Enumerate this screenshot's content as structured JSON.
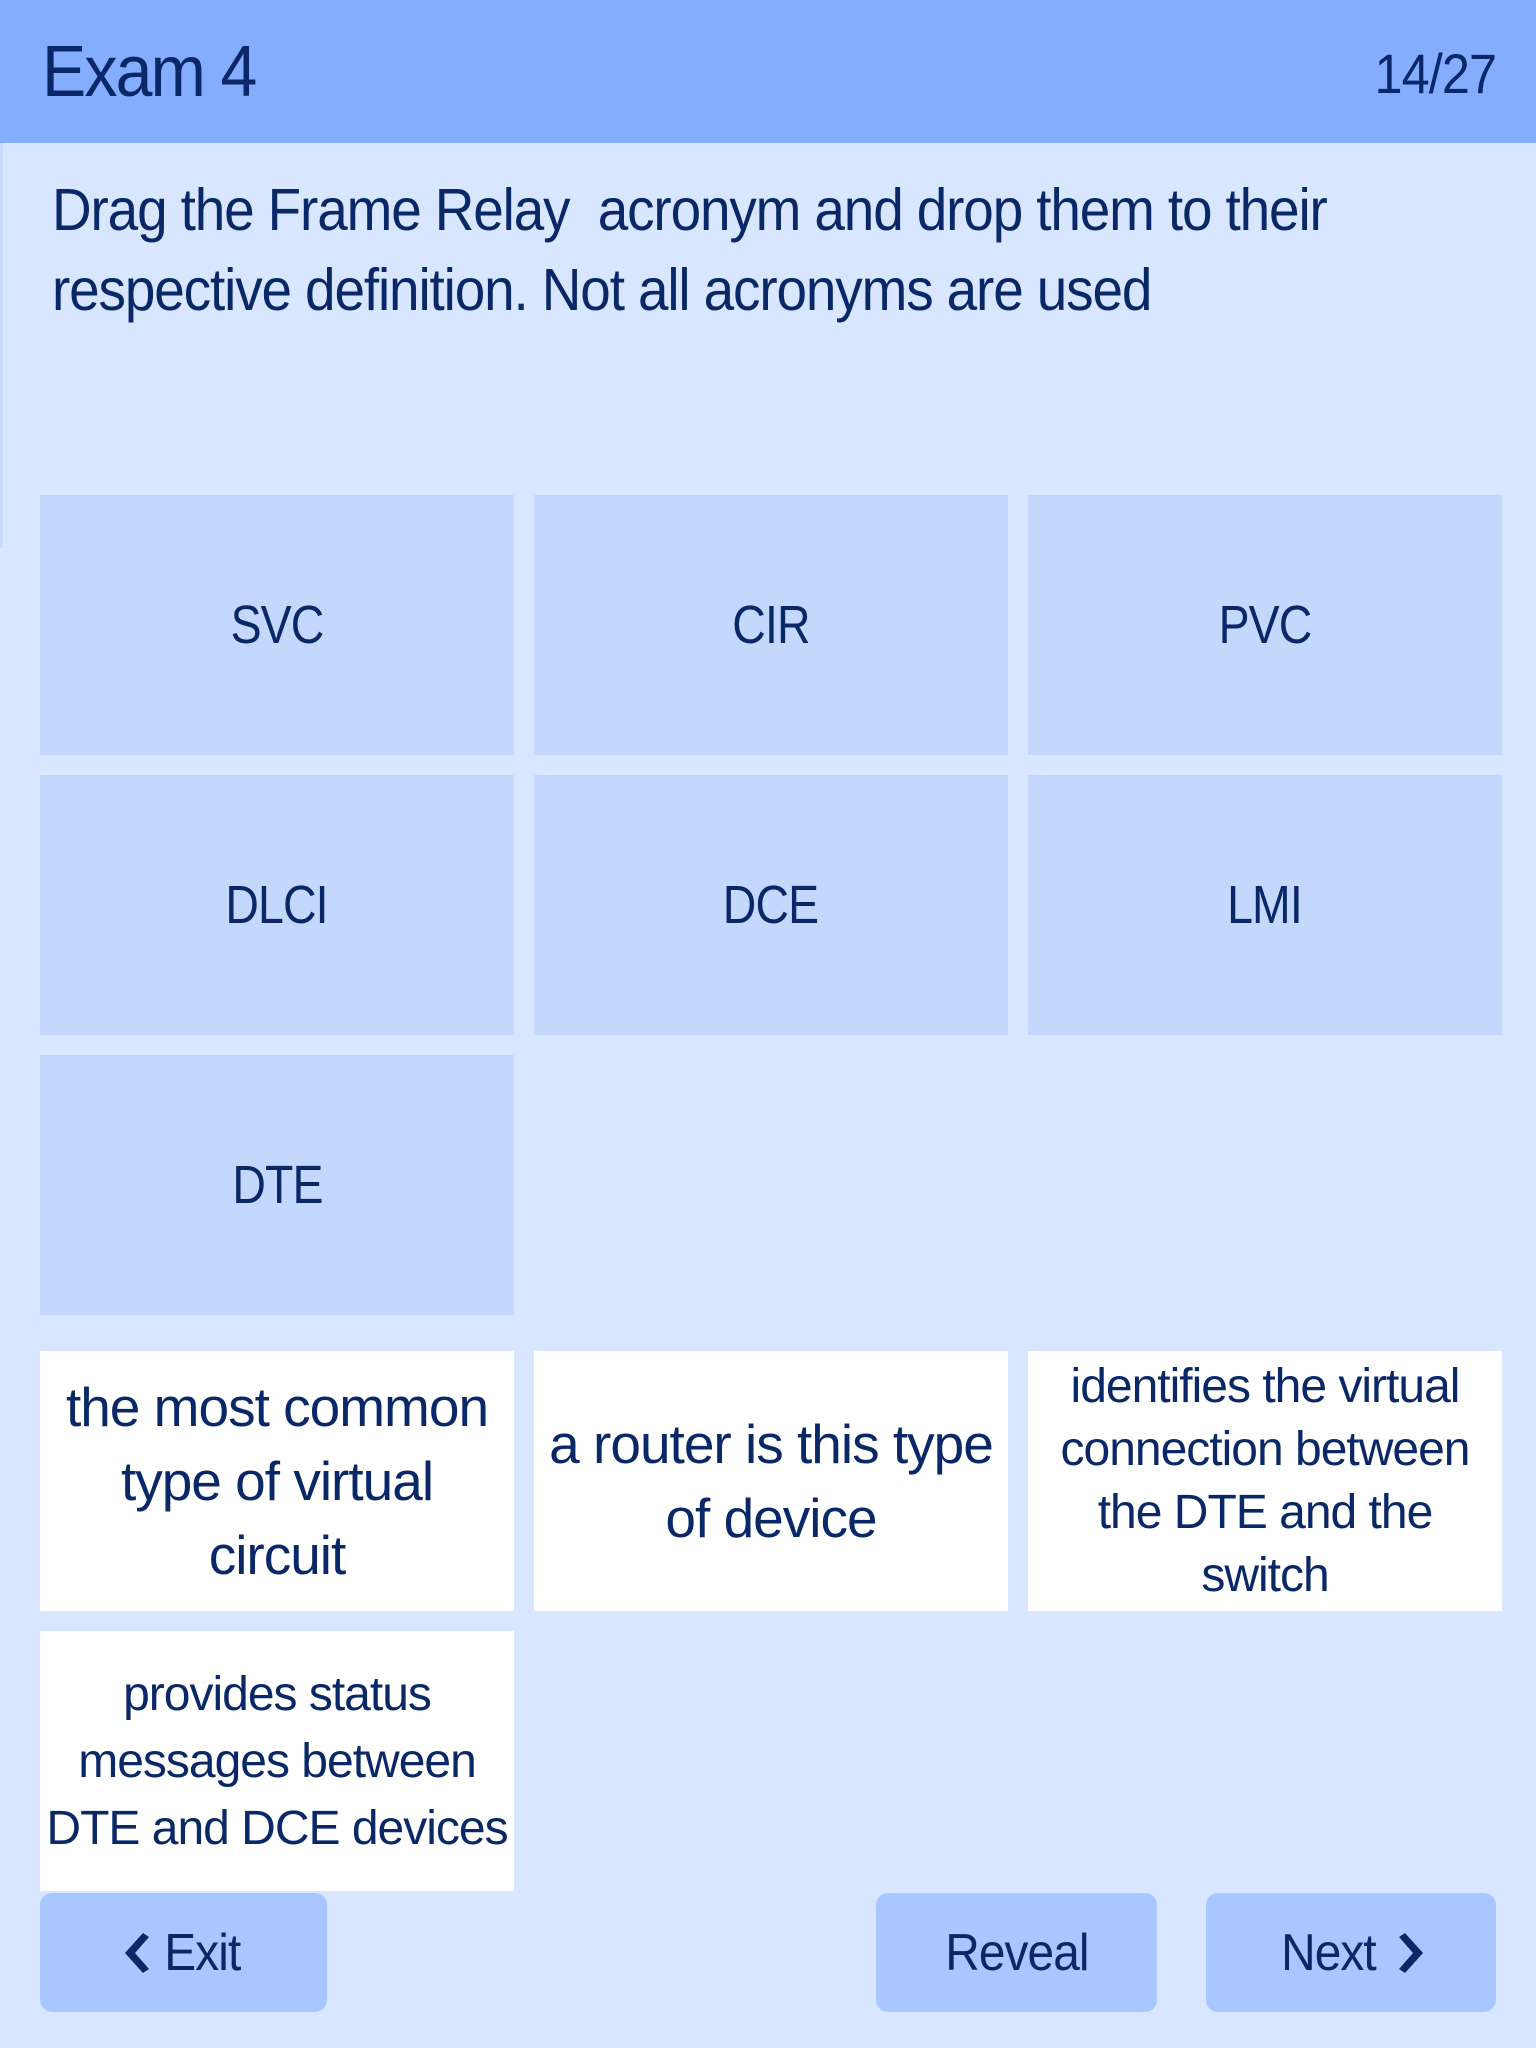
{
  "header": {
    "title": "Exam 4",
    "progress": "14/27"
  },
  "question": {
    "text": "Drag the Frame Relay  acronym and drop them to their respective definition. Not all acronyms are used"
  },
  "acronyms": [
    {
      "label": "SVC"
    },
    {
      "label": "CIR"
    },
    {
      "label": "PVC"
    },
    {
      "label": "DLCI"
    },
    {
      "label": "DCE"
    },
    {
      "label": "LMI"
    },
    {
      "label": "DTE"
    }
  ],
  "definitions": [
    {
      "text": "the most common type of virtual circuit"
    },
    {
      "text": "a router is this type of device"
    },
    {
      "text": "identifies the virtual connection between the DTE and the switch"
    },
    {
      "text": "provides status messages between DTE and DCE devices"
    }
  ],
  "footer": {
    "exit_label": "Exit",
    "exit_icon": "chevron-left-icon",
    "reveal_label": "Reveal",
    "next_label": "Next",
    "next_icon": "chevron-right-icon"
  },
  "colors": {
    "header_bg": "#85ADFF",
    "page_bg": "#D8E6FF",
    "acronym_tile_bg": "#C4D7FD",
    "definition_tile_bg": "#FFFFFF",
    "button_bg": "#A8C6FF",
    "text": "#0A2768"
  }
}
